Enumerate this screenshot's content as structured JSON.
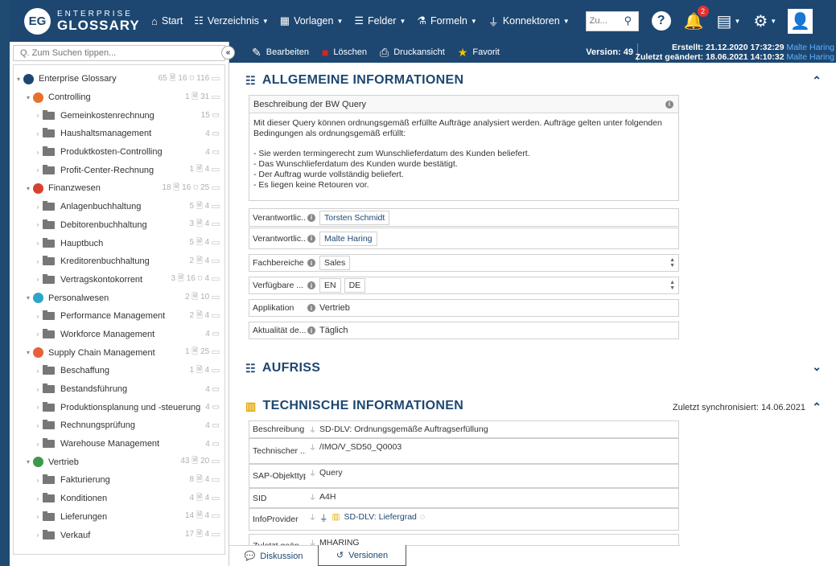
{
  "app": {
    "logo_line1": "ENTERPRISE",
    "logo_line2": "GLOSSARY",
    "logo_mark": "EG"
  },
  "nav": {
    "items": [
      {
        "label": "Start",
        "icon": "home-icon",
        "caret": false
      },
      {
        "label": "Verzeichnis",
        "icon": "hierarchy-icon",
        "caret": true
      },
      {
        "label": "Vorlagen",
        "icon": "grid-icon",
        "caret": true
      },
      {
        "label": "Felder",
        "icon": "list-icon",
        "caret": true
      },
      {
        "label": "Formeln",
        "icon": "flask-icon",
        "caret": true
      },
      {
        "label": "Konnektoren",
        "icon": "plug-icon",
        "caret": true
      }
    ],
    "search_placeholder": "Zu...",
    "notification_count": "2"
  },
  "sidebar": {
    "search_placeholder": "Q. Zum Suchen tippen...",
    "tree": [
      {
        "label": "Enterprise Glossary",
        "level": 0,
        "expanded": true,
        "kind": "root",
        "count": "65 🗎 16 ⛉ 116 ▭"
      },
      {
        "label": "Controlling",
        "level": 1,
        "expanded": true,
        "kind": "cat",
        "color": "#e8702a",
        "count": "1 🗎 31 ▭"
      },
      {
        "label": "Gemeinkostenrechnung",
        "level": 2,
        "kind": "folder",
        "count": "15 ▭"
      },
      {
        "label": "Haushaltsmanagement",
        "level": 2,
        "kind": "folder",
        "count": "4 ▭"
      },
      {
        "label": "Produktkosten-Controlling",
        "level": 2,
        "kind": "folder",
        "count": "4 ▭"
      },
      {
        "label": "Profit-Center-Rechnung",
        "level": 2,
        "kind": "folder",
        "count": "1 🗎 4 ▭"
      },
      {
        "label": "Finanzwesen",
        "level": 1,
        "expanded": true,
        "kind": "cat",
        "color": "#d9412f",
        "count": "18 🗎 16 ⛉ 25 ▭"
      },
      {
        "label": "Anlagenbuchhaltung",
        "level": 2,
        "kind": "folder",
        "count": "5 🗎 4 ▭"
      },
      {
        "label": "Debitorenbuchhaltung",
        "level": 2,
        "kind": "folder",
        "count": "3 🗎 4 ▭"
      },
      {
        "label": "Hauptbuch",
        "level": 2,
        "kind": "folder",
        "count": "5 🗎 4 ▭"
      },
      {
        "label": "Kreditorenbuchhaltung",
        "level": 2,
        "kind": "folder",
        "count": "2 🗎 4 ▭"
      },
      {
        "label": "Vertragskontokorrent",
        "level": 2,
        "kind": "folder",
        "count": "3 🗎 16 ⛉ 4 ▭"
      },
      {
        "label": "Personalwesen",
        "level": 1,
        "expanded": true,
        "kind": "cat",
        "color": "#2ca6c9",
        "count": "2 🗎 10 ▭"
      },
      {
        "label": "Performance Management",
        "level": 2,
        "kind": "folder",
        "count": "2 🗎 4 ▭"
      },
      {
        "label": "Workforce Management",
        "level": 2,
        "kind": "folder",
        "count": "4 ▭"
      },
      {
        "label": "Supply Chain Management",
        "level": 1,
        "expanded": true,
        "kind": "cat",
        "color": "#e8603a",
        "count": "1 🗎 25 ▭"
      },
      {
        "label": "Beschaffung",
        "level": 2,
        "kind": "folder",
        "count": "1 🗎 4 ▭"
      },
      {
        "label": "Bestandsführung",
        "level": 2,
        "kind": "folder",
        "count": "4 ▭"
      },
      {
        "label": "Produktionsplanung und -steuerung",
        "level": 2,
        "kind": "folder",
        "count": "4 ▭"
      },
      {
        "label": "Rechnungsprüfung",
        "level": 2,
        "kind": "folder",
        "count": "4 ▭"
      },
      {
        "label": "Warehouse Management",
        "level": 2,
        "kind": "folder",
        "count": "4 ▭"
      },
      {
        "label": "Vertrieb",
        "level": 1,
        "expanded": true,
        "kind": "cat",
        "color": "#3a9a4a",
        "count": "43 🗎 20 ▭"
      },
      {
        "label": "Fakturierung",
        "level": 2,
        "kind": "folder",
        "count": "8 🗎 4 ▭"
      },
      {
        "label": "Konditionen",
        "level": 2,
        "kind": "folder",
        "count": "4 🗎 4 ▭"
      },
      {
        "label": "Lieferungen",
        "level": 2,
        "kind": "folder",
        "count": "14 🗎 4 ▭"
      },
      {
        "label": "Verkauf",
        "level": 2,
        "kind": "folder",
        "count": "17 🗎 4 ▭"
      }
    ]
  },
  "toolbar": {
    "edit": "Bearbeiten",
    "delete": "Löschen",
    "print": "Druckansicht",
    "favorite": "Favorit",
    "version": "Version: 49",
    "created_label": "Erstellt: 21.12.2020 17:32:29",
    "created_by": "Malte Haring",
    "changed_label": "Zuletzt geändert: 18.06.2021 14:10:32",
    "changed_by": "Malte Haring"
  },
  "general": {
    "title": "ALLGEMEINE INFORMATIONEN",
    "desc_label": "Beschreibung der BW Query",
    "desc_text": "Mit dieser Query können ordnungsgemäß erfüllte Aufträge analysiert werden. Aufträge gelten unter folgenden Bedingungen als ordnungsgemäß erfüllt:\n\n- Sie werden termingerecht zum Wunschlieferdatum des Kunden beliefert.\n- Das Wunschlieferdatum des Kunden wurde bestätigt.\n- Der Auftrag wurde vollständig beliefert.\n- Es liegen keine Retouren vor.",
    "fields": [
      {
        "label": "Verantwortlic...",
        "values": [
          "Torsten Schmidt"
        ],
        "link": true
      },
      {
        "label": "Verantwortlic...",
        "values": [
          "Malte Haring"
        ],
        "link": true
      },
      {
        "label": "Fachbereiche",
        "values": [
          "Sales"
        ],
        "spin": true
      },
      {
        "label": "Verfügbare ...",
        "values": [
          "EN",
          "DE"
        ],
        "spin": true
      },
      {
        "label": "Applikation",
        "text": "Vertrieb"
      },
      {
        "label": "Aktualität de...",
        "text": "Täglich"
      }
    ]
  },
  "aufriss": {
    "title": "AUFRISS"
  },
  "technical": {
    "title": "TECHNISCHE INFORMATIONEN",
    "sync": "Zuletzt synchronisiert: 14.06.2021",
    "rows": [
      {
        "label": "Beschreibung",
        "value": "SD-DLV: Ordnungsgemäße Auftragserfüllung"
      },
      {
        "label": "Technischer ...",
        "value": "/IMO/V_SD50_Q0003"
      },
      {
        "label": "SAP-Objekttyp",
        "value": "Query"
      },
      {
        "label": "SID",
        "value": "A4H"
      },
      {
        "label": "InfoProvider",
        "value": "SD-DLV: Liefergrad"
      },
      {
        "label": "Zuletzt geän...",
        "value": "MHARING"
      }
    ]
  },
  "bottom_tabs": {
    "discussion": "Diskussion",
    "versions": "Versionen"
  }
}
